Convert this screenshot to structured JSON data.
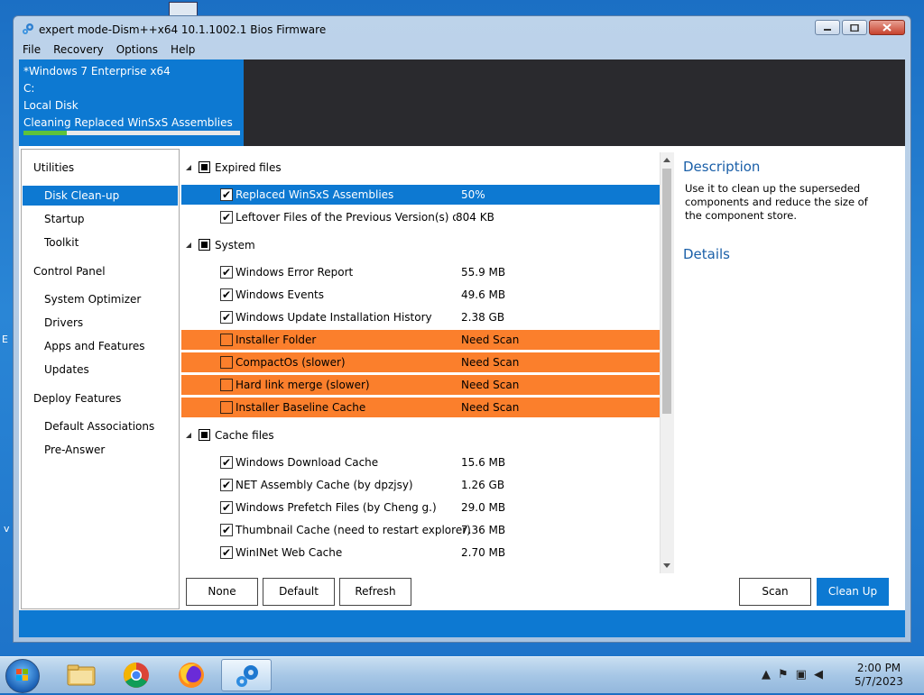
{
  "window": {
    "title": "expert mode-Dism++x64 10.1.1002.1 Bios Firmware"
  },
  "menu": [
    "File",
    "Recovery",
    "Options",
    "Help"
  ],
  "status": {
    "os": "*Windows 7 Enterprise x64",
    "drive": "C:",
    "disk": "Local Disk",
    "task": "Cleaning Replaced WinSxS Assemblies",
    "progress_percent": 20,
    "progress_color": "#5ec23c"
  },
  "sidebar": {
    "sections": [
      {
        "header": "Utilities",
        "items": [
          "Disk Clean-up",
          "Startup",
          "Toolkit"
        ]
      },
      {
        "header": "Control Panel",
        "items": [
          "System Optimizer",
          "Drivers",
          "Apps and Features",
          "Updates"
        ]
      },
      {
        "header": "Deploy Features",
        "items": [
          "Default Associations",
          "Pre-Answer"
        ]
      }
    ],
    "active_item": "Disk Clean-up"
  },
  "list": {
    "groups": [
      {
        "label": "Expired files",
        "rows": [
          {
            "name": "Replaced WinSxS Assemblies",
            "size": "50%",
            "checked": true,
            "state": "selected"
          },
          {
            "name": "Leftover Files of the Previous Version(s) of Dism",
            "size": "804 KB",
            "checked": true,
            "state": "normal"
          }
        ]
      },
      {
        "label": "System",
        "rows": [
          {
            "name": "Windows Error Report",
            "size": "55.9 MB",
            "checked": true,
            "state": "normal"
          },
          {
            "name": "Windows Events",
            "size": "49.6 MB",
            "checked": true,
            "state": "normal"
          },
          {
            "name": "Windows Update Installation History",
            "size": "2.38 GB",
            "checked": true,
            "state": "normal"
          },
          {
            "name": "Installer Folder",
            "size": "Need Scan",
            "checked": false,
            "state": "warn"
          },
          {
            "name": "CompactOs (slower)",
            "size": "Need Scan",
            "checked": false,
            "state": "warn"
          },
          {
            "name": "Hard link merge (slower)",
            "size": "Need Scan",
            "checked": false,
            "state": "warn"
          },
          {
            "name": "Installer Baseline Cache",
            "size": "Need Scan",
            "checked": false,
            "state": "warn"
          }
        ]
      },
      {
        "label": "Cache files",
        "rows": [
          {
            "name": "Windows Download Cache",
            "size": "15.6 MB",
            "checked": true,
            "state": "normal"
          },
          {
            "name": "NET Assembly Cache (by dpzjsy)",
            "size": "1.26 GB",
            "checked": true,
            "state": "normal"
          },
          {
            "name": "Windows Prefetch Files (by Cheng g.)",
            "size": "29.0 MB",
            "checked": true,
            "state": "normal"
          },
          {
            "name": "Thumbnail Cache (need to restart explorer)",
            "size": "7.36 MB",
            "checked": true,
            "state": "normal"
          },
          {
            "name": "WinINet Web Cache",
            "size": "2.70 MB",
            "checked": true,
            "state": "normal"
          }
        ]
      }
    ],
    "colors": {
      "selected": "#0d79d2",
      "warn": "#fb7f2c"
    }
  },
  "description": {
    "heading": "Description",
    "text": "Use it to clean up the superseded components and reduce the size of the component store.",
    "details_heading": "Details"
  },
  "buttons": {
    "none": "None",
    "default": "Default",
    "refresh": "Refresh",
    "scan": "Scan",
    "cleanup": "Clean Up"
  },
  "taskbar": {
    "time": "2:00 PM",
    "date": "5/7/2023"
  },
  "icons": {
    "app": "gear-icon",
    "explorer": "folder-icon",
    "chrome": "chrome-icon",
    "firefox": "firefox-icon",
    "dism": "gears-icon"
  }
}
